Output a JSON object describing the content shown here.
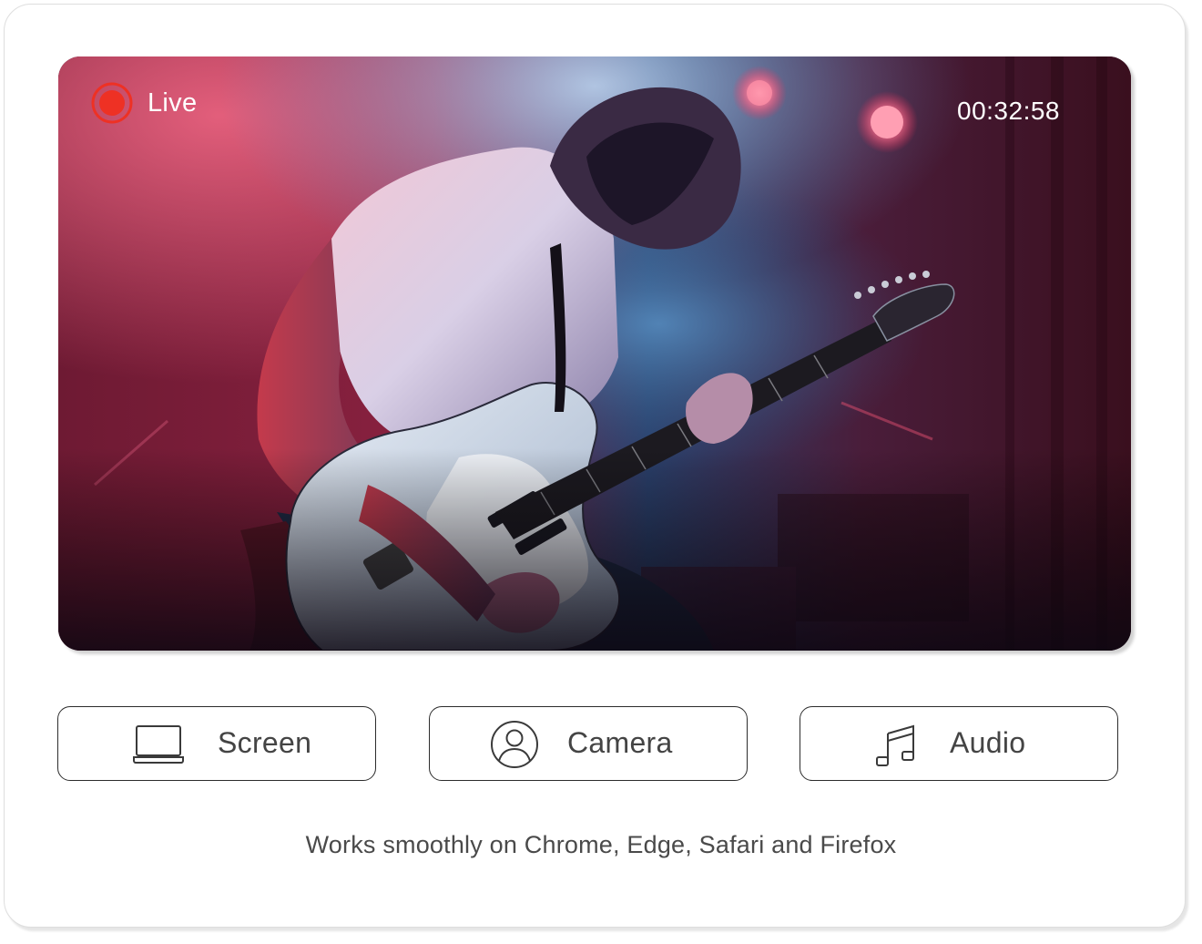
{
  "stream": {
    "status_label": "Live",
    "elapsed_time": "00:32:58",
    "accent_color": "#ee3124"
  },
  "sources": [
    {
      "label": "Screen",
      "icon": "laptop-icon"
    },
    {
      "label": "Camera",
      "icon": "user-icon"
    },
    {
      "label": "Audio",
      "icon": "music-note-icon"
    }
  ],
  "footer": {
    "compatibility_text": "Works smoothly on Chrome, Edge, Safari and Firefox"
  }
}
